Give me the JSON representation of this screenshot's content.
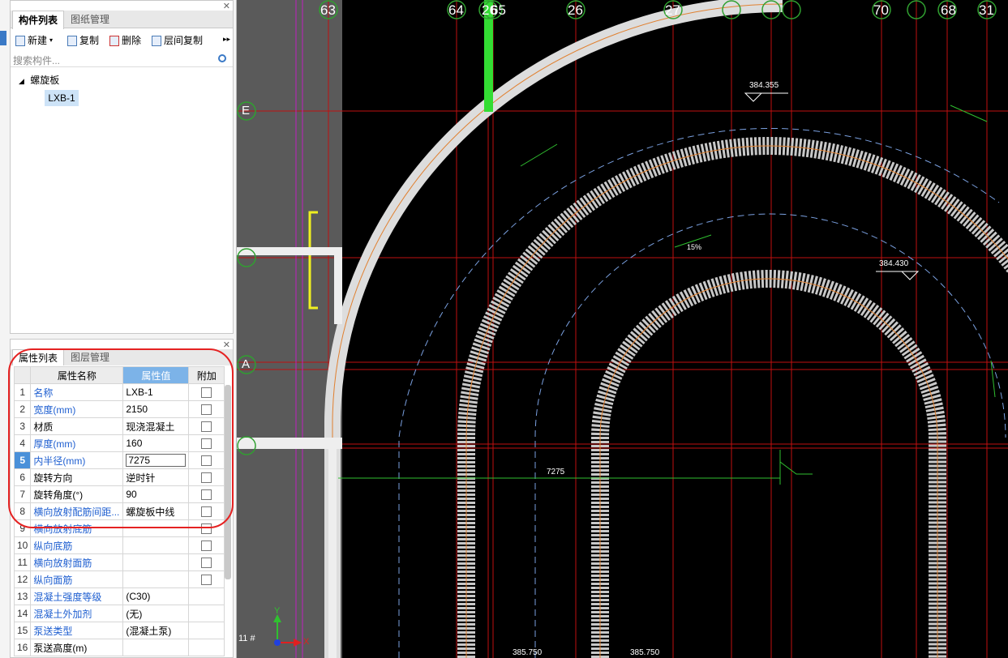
{
  "component_panel": {
    "tabs": [
      "构件列表",
      "图纸管理"
    ],
    "toolbar": {
      "new": "新建",
      "copy": "复制",
      "delete": "删除",
      "floor_copy": "层间复制"
    },
    "search_placeholder": "搜索构件...",
    "tree": {
      "root": "螺旋板",
      "child": "LXB-1"
    }
  },
  "property_panel": {
    "tabs": [
      "属性列表",
      "图层管理"
    ],
    "headers": {
      "name": "属性名称",
      "value": "属性值",
      "extra": "附加"
    },
    "rows": [
      {
        "num": "1",
        "name": "名称",
        "value": "LXB-1"
      },
      {
        "num": "2",
        "name": "宽度(mm)",
        "value": "2150"
      },
      {
        "num": "3",
        "name": "材质",
        "value": "现浇混凝土"
      },
      {
        "num": "4",
        "name": "厚度(mm)",
        "value": "160"
      },
      {
        "num": "5",
        "name": "内半径(mm)",
        "value": "7275"
      },
      {
        "num": "6",
        "name": "旋转方向",
        "value": "逆时针"
      },
      {
        "num": "7",
        "name": "旋转角度(°)",
        "value": "90"
      },
      {
        "num": "8",
        "name": "横向放射配筋间距...",
        "value": "螺旋板中线"
      },
      {
        "num": "9",
        "name": "横向放射底筋",
        "value": ""
      },
      {
        "num": "10",
        "name": "纵向底筋",
        "value": ""
      },
      {
        "num": "11",
        "name": "横向放射面筋",
        "value": ""
      },
      {
        "num": "12",
        "name": "纵向面筋",
        "value": ""
      },
      {
        "num": "13",
        "name": "混凝土强度等级",
        "value": "(C30)"
      },
      {
        "num": "14",
        "name": "混凝土外加剂",
        "value": "(无)"
      },
      {
        "num": "15",
        "name": "泵送类型",
        "value": "(混凝土泵)"
      },
      {
        "num": "16",
        "name": "泵送高度(m)",
        "value": ""
      }
    ]
  },
  "cad": {
    "axis_top": [
      "63",
      "64",
      "26",
      "65",
      "26",
      "27",
      "70",
      "68",
      "31"
    ],
    "axis_left": [
      "E",
      "A"
    ],
    "elev_1": "384.355",
    "elev_2": "384.430",
    "elev_3": "385.750",
    "elev_4": "385.750",
    "slope": "15%",
    "dim": "7275",
    "ucs_y": "Y",
    "ucs_x": "X",
    "layer_label": "11 #"
  }
}
